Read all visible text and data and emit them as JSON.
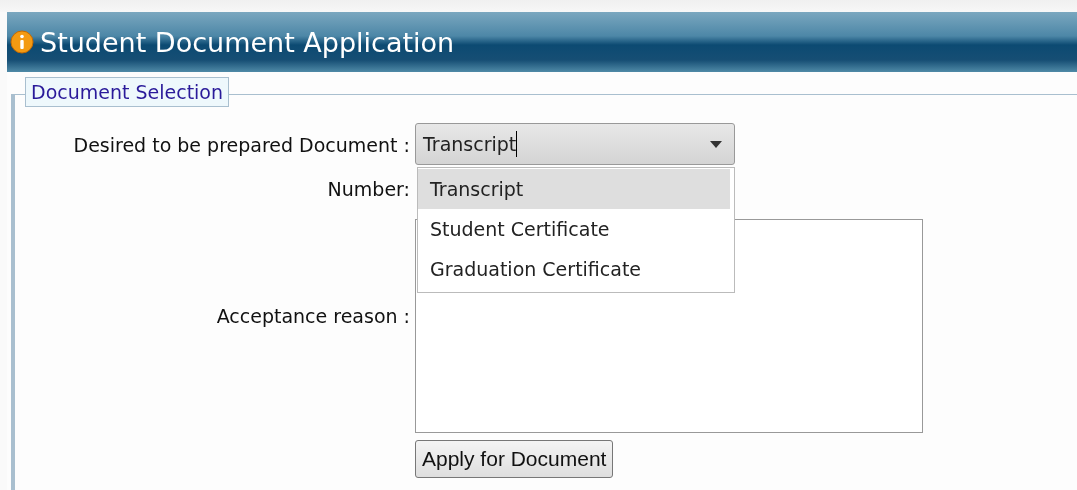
{
  "window": {
    "title": "Student Document Application"
  },
  "section": {
    "legend": "Document Selection"
  },
  "fields": [
    {
      "kind": "select",
      "label": "Desired to be prepared Document :",
      "value": "Transcript",
      "expanded": true,
      "options": [
        {
          "label": "Transcript",
          "selected": true
        },
        {
          "label": "Student Certificate",
          "selected": false
        },
        {
          "label": "Graduation Certificate",
          "selected": false
        }
      ]
    },
    {
      "kind": "hidden-input",
      "label": "Number:"
    },
    {
      "kind": "textarea",
      "label": "Acceptance reason :"
    }
  ],
  "submit": {
    "label": "Apply for Document"
  }
}
